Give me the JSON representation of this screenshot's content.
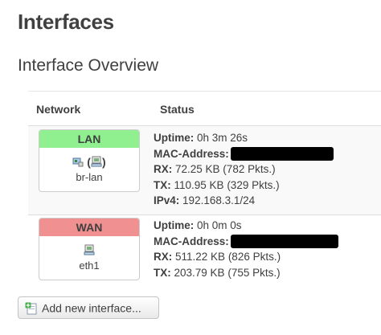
{
  "page": {
    "title": "Interfaces",
    "section_title": "Interface Overview"
  },
  "table": {
    "headers": {
      "network": "Network",
      "status": "Status"
    },
    "rows": [
      {
        "name": "LAN",
        "color": "#90f090",
        "device": "br-lan",
        "paren_open": "(",
        "paren_close": ")",
        "status": {
          "uptime_label": "Uptime:",
          "uptime_value": "0h 3m 26s",
          "mac_label": "MAC-Address:",
          "rx_label": "RX:",
          "rx_value": "72.25 KB (782 Pkts.)",
          "tx_label": "TX:",
          "tx_value": "110.95 KB (329 Pkts.)",
          "ipv4_label": "IPv4:",
          "ipv4_value": "192.168.3.1/24"
        }
      },
      {
        "name": "WAN",
        "color": "#f09090",
        "device": "eth1",
        "status": {
          "uptime_label": "Uptime:",
          "uptime_value": "0h 0m 0s",
          "mac_label": "MAC-Address:",
          "rx_label": "RX:",
          "rx_value": "511.22 KB (826 Pkts.)",
          "tx_label": "TX:",
          "tx_value": "203.79 KB (755 Pkts.)"
        }
      }
    ]
  },
  "actions": {
    "add_label": "Add new interface..."
  },
  "icons": {
    "lan_icons": [
      "network-card-icon",
      "bridge-network-icon"
    ],
    "wan_icon": "ethernet-port-icon",
    "add_icon": "add-document-icon"
  }
}
